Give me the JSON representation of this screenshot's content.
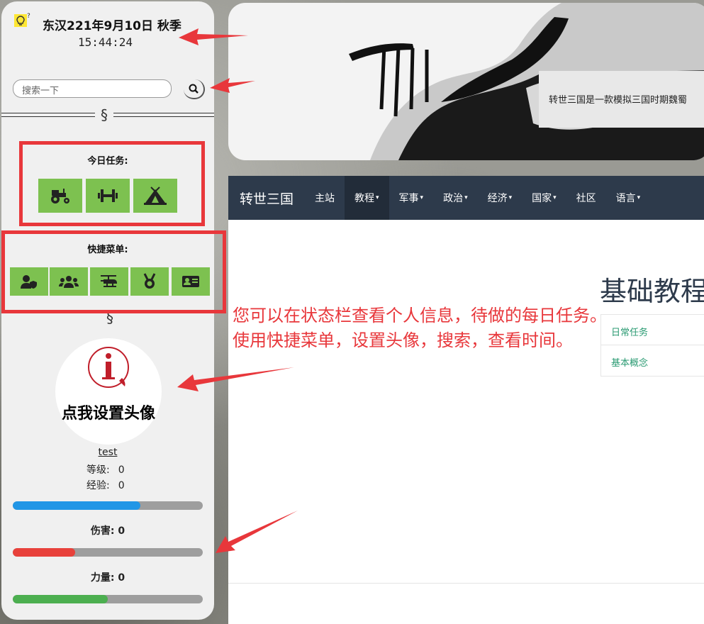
{
  "sidebar": {
    "date": "东汉221年9月10日 秋季",
    "time": "15:44:24",
    "search_placeholder": "搜索一下",
    "section_symbol": "§",
    "tasks": {
      "title": "今日任务:",
      "buttons": [
        "tractor-icon",
        "dumbbell-icon",
        "campground-icon"
      ]
    },
    "quick_menu": {
      "title": "快捷菜单:",
      "buttons": [
        "user-shield-icon",
        "users-icon",
        "helicopter-icon",
        "medal-icon",
        "id-card-icon"
      ]
    },
    "avatar": {
      "label": "点我设置头像",
      "icon": "info-icon"
    },
    "user": {
      "name": "test",
      "level_label": "等级:",
      "level_value": "0",
      "exp_label": "经验:",
      "exp_value": "0"
    },
    "bars": {
      "exp_fill": 0.67,
      "damage_label": "伤害: 0",
      "damage_fill": 0.33,
      "strength_label": "力量: 0",
      "strength_fill": 0.5
    },
    "colors": {
      "exp": "#2196e6",
      "damage": "#e8413b",
      "strength": "#4caf50",
      "button": "#7dc150",
      "annotation": "#e8373b"
    }
  },
  "hero": {
    "caption": "转世三国是一款模拟三国时期魏蜀"
  },
  "navbar": {
    "brand": "转世三国",
    "items": [
      {
        "label": "主站"
      },
      {
        "label": "教程",
        "dropdown": true,
        "active": true
      },
      {
        "label": "军事",
        "dropdown": true
      },
      {
        "label": "政治",
        "dropdown": true
      },
      {
        "label": "经济",
        "dropdown": true
      },
      {
        "label": "国家",
        "dropdown": true
      },
      {
        "label": "社区"
      },
      {
        "label": "语言",
        "dropdown": true
      }
    ]
  },
  "content": {
    "heading": "基础教程",
    "side_list": [
      "日常任务",
      "基本概念"
    ]
  },
  "annotation": {
    "line1": "您可以在状态栏查看个人信息，待做的每日任务。",
    "line2": "使用快捷菜单，设置头像，搜索，查看时间。"
  }
}
